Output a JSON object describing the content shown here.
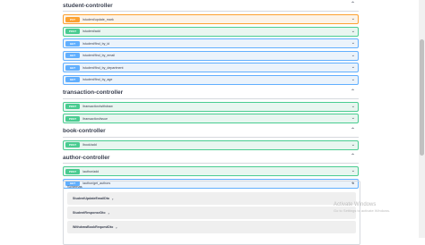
{
  "sections": [
    {
      "title": "student-controller",
      "ops": [
        {
          "method": "PUT",
          "path": "/student/update_mark",
          "cls": "put"
        },
        {
          "method": "POST",
          "path": "/student/add",
          "cls": "post"
        },
        {
          "method": "GET",
          "path": "/student/find_by_id",
          "cls": "get"
        },
        {
          "method": "GET",
          "path": "/student/find_by_email",
          "cls": "get"
        },
        {
          "method": "GET",
          "path": "/student/find_by_department",
          "cls": "get"
        },
        {
          "method": "GET",
          "path": "/student/find_by_age",
          "cls": "get"
        }
      ]
    },
    {
      "title": "transaction-controller",
      "ops": [
        {
          "method": "POST",
          "path": "/transaction/withdraw",
          "cls": "post"
        },
        {
          "method": "POST",
          "path": "/transaction/issue",
          "cls": "post"
        }
      ]
    },
    {
      "title": "book-controller",
      "ops": [
        {
          "method": "POST",
          "path": "/book/add",
          "cls": "post"
        }
      ]
    },
    {
      "title": "author-controller",
      "ops": [
        {
          "method": "POST",
          "path": "/author/add",
          "cls": "post"
        },
        {
          "method": "GET",
          "path": "/author/get_authors",
          "cls": "get"
        }
      ]
    }
  ],
  "schemas": {
    "title": "Schemas",
    "items": [
      "StudentUpdateEmailDto",
      "StudentResponseDto",
      "WithdrawBookRequestDto"
    ]
  },
  "watermark": {
    "line1": "Activate Windows",
    "line2": "Go to Settings to activate Windows."
  },
  "icons": {
    "collapse": "chevron-up-icon",
    "expand": "chevron-down-icon",
    "schema_expand": "chevron-right-icon"
  }
}
